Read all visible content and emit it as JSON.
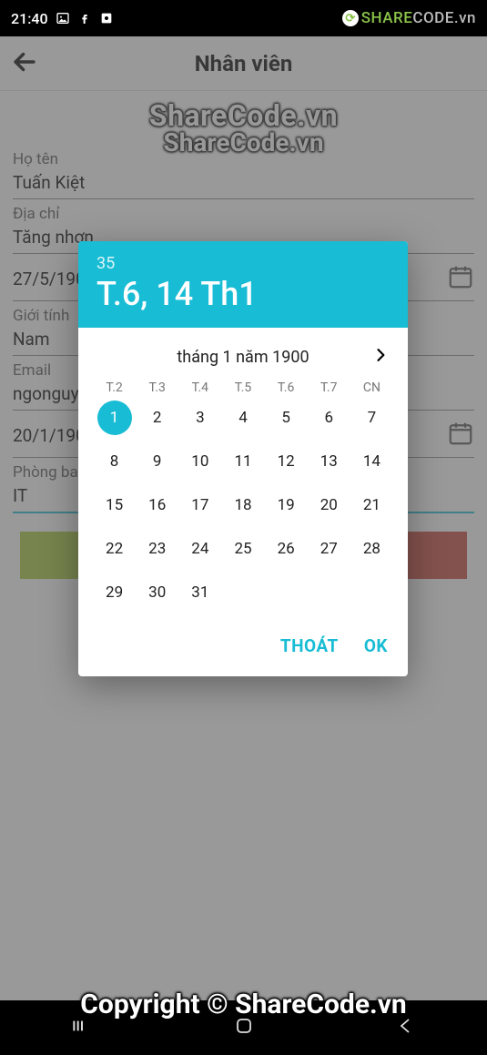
{
  "statusbar": {
    "time": "21:40",
    "brandA": "SHARE",
    "brandB": "CODE",
    "brandC": ".vn"
  },
  "appbar": {
    "title": "Nhân viên"
  },
  "watermark": {
    "line1": "ShareCode.vn",
    "line2": "ShareCode.vn",
    "footer": "Copyright © ShareCode.vn"
  },
  "form": {
    "name_label": "Họ tên",
    "name_value": "Tuấn Kiệt",
    "addr_label": "Địa chỉ",
    "addr_value": "Tăng nhơn",
    "dob_value": "27/5/190",
    "gender_label": "Giới tính",
    "gender_value": "Nam",
    "email_label": "Email",
    "email_value": "ngonguye",
    "date2_value": "20/1/190",
    "dept_label": "Phòng ban",
    "dept_value": "IT"
  },
  "picker": {
    "year": "35",
    "headline": "T.6, 14 Th1",
    "month_label": "tháng 1 năm 1900",
    "dow": [
      "T.2",
      "T.3",
      "T.4",
      "T.5",
      "T.6",
      "T.7",
      "CN"
    ],
    "days": [
      [
        1,
        2,
        3,
        4,
        5,
        6,
        7
      ],
      [
        8,
        9,
        10,
        11,
        12,
        13,
        14
      ],
      [
        15,
        16,
        17,
        18,
        19,
        20,
        21
      ],
      [
        22,
        23,
        24,
        25,
        26,
        27,
        28
      ],
      [
        29,
        30,
        31
      ]
    ],
    "selected": 1,
    "cancel": "THOÁT",
    "ok": "OK"
  }
}
